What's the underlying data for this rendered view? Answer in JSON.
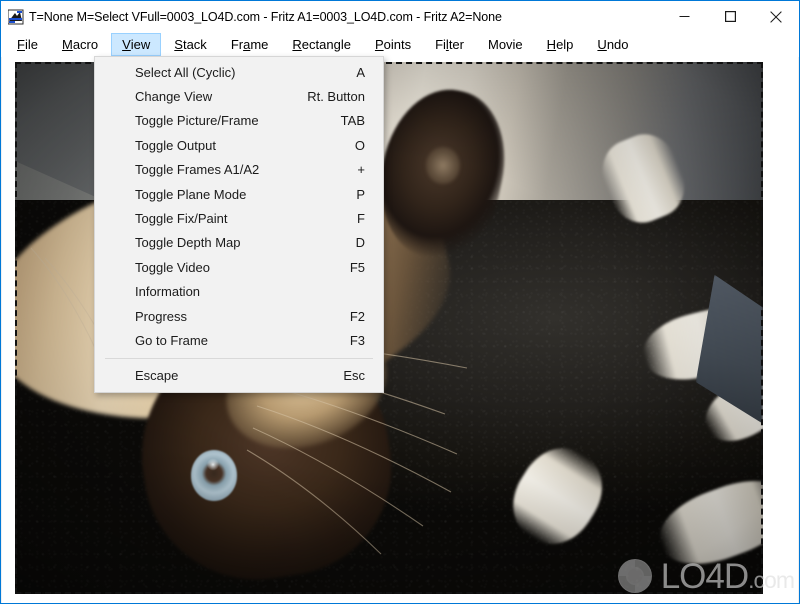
{
  "window": {
    "title": "T=None M=Select VFull=0003_LO4D.com - Fritz A1=0003_LO4D.com - Fritz A2=None",
    "icon_name": "scanner-app-icon",
    "accent_color": "#0078d7",
    "controls": {
      "minimize_label": "Minimize",
      "maximize_label": "Maximize",
      "close_label": "Close"
    }
  },
  "menubar": {
    "items": [
      {
        "label": "File",
        "mnemonic": "F",
        "active": false
      },
      {
        "label": "Macro",
        "mnemonic": "M",
        "active": false
      },
      {
        "label": "View",
        "mnemonic": "V",
        "active": true
      },
      {
        "label": "Stack",
        "mnemonic": "S",
        "active": false
      },
      {
        "label": "Frame",
        "mnemonic": "a",
        "active": false
      },
      {
        "label": "Rectangle",
        "mnemonic": "R",
        "active": false
      },
      {
        "label": "Points",
        "mnemonic": "P",
        "active": false
      },
      {
        "label": "Filter",
        "mnemonic": "l",
        "active": false
      },
      {
        "label": "Movie",
        "mnemonic": "",
        "active": false
      },
      {
        "label": "Help",
        "mnemonic": "H",
        "active": false
      },
      {
        "label": "Undo",
        "mnemonic": "U",
        "active": false
      }
    ]
  },
  "view_menu": {
    "open": true,
    "items": [
      {
        "label": "Select All (Cyclic)",
        "accel": "A",
        "separator_after": false
      },
      {
        "label": "Change View",
        "accel": "Rt. Button",
        "separator_after": false
      },
      {
        "label": "Toggle Picture/Frame",
        "accel": "TAB",
        "separator_after": false
      },
      {
        "label": "Toggle Output",
        "accel": "O",
        "separator_after": false
      },
      {
        "label": "Toggle Frames A1/A2",
        "accel": "+",
        "separator_after": false
      },
      {
        "label": "Toggle Plane Mode",
        "accel": "P",
        "separator_after": false
      },
      {
        "label": "Toggle Fix/Paint",
        "accel": "F",
        "separator_after": false
      },
      {
        "label": "Toggle Depth Map",
        "accel": "D",
        "separator_after": false
      },
      {
        "label": "Toggle Video",
        "accel": "F5",
        "separator_after": false
      },
      {
        "label": "Information",
        "accel": "",
        "separator_after": false
      },
      {
        "label": "Progress",
        "accel": "F2",
        "separator_after": false
      },
      {
        "label": "Go to Frame",
        "accel": "F3",
        "separator_after": true
      },
      {
        "label": "Escape",
        "accel": "Esc",
        "separator_after": false
      }
    ]
  },
  "canvas": {
    "name": "image-canvas",
    "description": "Photograph of a Siamese cat lying upside down on a black and white textured blanket",
    "selection_style": "dashed-marching-ants"
  },
  "watermark": {
    "text": "LO4D",
    "tld": ".com",
    "logo_name": "lo4d-logo-icon"
  }
}
